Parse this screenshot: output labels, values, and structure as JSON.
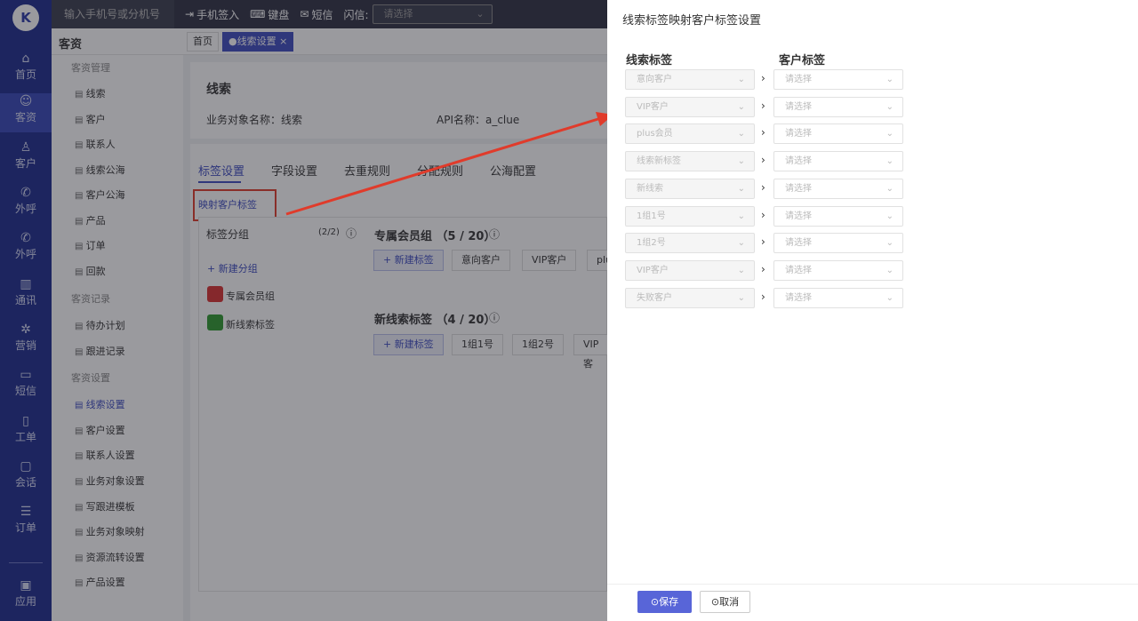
{
  "nav": {
    "logo": "K",
    "items": [
      {
        "label": "首页",
        "icon": "home-icon"
      },
      {
        "label": "客资",
        "icon": "users-icon"
      },
      {
        "label": "客户",
        "icon": "person-icon"
      },
      {
        "label": "外呼",
        "icon": "phone-icon"
      },
      {
        "label": "外呼",
        "icon": "phone-out-icon"
      },
      {
        "label": "通讯",
        "icon": "address-book-icon"
      },
      {
        "label": "营销",
        "icon": "gear-icon"
      },
      {
        "label": "短信",
        "icon": "message-icon"
      },
      {
        "label": "工单",
        "icon": "clipboard-icon"
      },
      {
        "label": "会话",
        "icon": "chat-icon"
      },
      {
        "label": "订单",
        "icon": "list-icon"
      },
      {
        "label": "应用",
        "icon": "apps-icon"
      }
    ]
  },
  "topbar": {
    "phone_placeholder": "输入手机号或分机号",
    "phone_signin": "手机签入",
    "keyboard": "键盘",
    "sms": "短信",
    "flash_label": "闪信:",
    "flash_placeholder": "请选择"
  },
  "subhead": {
    "module": "客资",
    "tab_home": "首页",
    "tab_current": "●线索设置 ×"
  },
  "side": {
    "group1": "客资管理",
    "group1_items": [
      "线索",
      "客户",
      "联系人",
      "线索公海",
      "客户公海",
      "产品",
      "订单",
      "回款"
    ],
    "group2": "客资记录",
    "group2_items": [
      "待办计划",
      "跟进记录"
    ],
    "group3": "客资设置",
    "group3_items": [
      "线索设置",
      "客户设置",
      "联系人设置",
      "业务对象设置",
      "写跟进模板",
      "业务对象映射",
      "资源流转设置",
      "产品设置"
    ]
  },
  "content": {
    "title": "线索",
    "obj_name": "业务对象名称：线索",
    "api_name": "API名称：a_clue",
    "tabs": [
      "标签设置",
      "字段设置",
      "去重规则",
      "分配规则",
      "公海配置"
    ],
    "map_link": "映射客户标签",
    "group_header": "标签分组",
    "group_count": "(2/2)",
    "new_group": "+ 新建分组",
    "groups": [
      {
        "name": "专属会员组",
        "color": "#d93030"
      },
      {
        "name": "新线索标签",
        "color": "#2e9a2e"
      }
    ],
    "section1_title": "专属会员组 （5 / 20）",
    "section1_new": "+ 新建标签",
    "section1_chips": [
      "意向客户",
      "VIP客户",
      "plu"
    ],
    "section2_title": "新线索标签 （4 / 20）",
    "section2_new": "+ 新建标签",
    "section2_chips": [
      "1组1号",
      "1组2号",
      "VIP客"
    ]
  },
  "drawer": {
    "title": "线索标签映射客户标签设置",
    "col_left": "线索标签",
    "col_right": "客户标签",
    "rows": [
      {
        "clue": "意向客户",
        "customer": "请选择"
      },
      {
        "clue": "VIP客户",
        "customer": "请选择"
      },
      {
        "clue": "plus会员",
        "customer": "请选择"
      },
      {
        "clue": "线索新标签",
        "customer": "请选择"
      },
      {
        "clue": "新线索",
        "customer": "请选择"
      },
      {
        "clue": "1组1号",
        "customer": "请选择"
      },
      {
        "clue": "1组2号",
        "customer": "请选择"
      },
      {
        "clue": "VIP客户",
        "customer": "请选择"
      },
      {
        "clue": "失败客户",
        "customer": "请选择"
      }
    ],
    "save": "⊙保存",
    "cancel": "⊙取消"
  },
  "colors": {
    "accent": "#3d4bc0",
    "nav": "#1c2a8c",
    "callout": "#e03b2b"
  }
}
